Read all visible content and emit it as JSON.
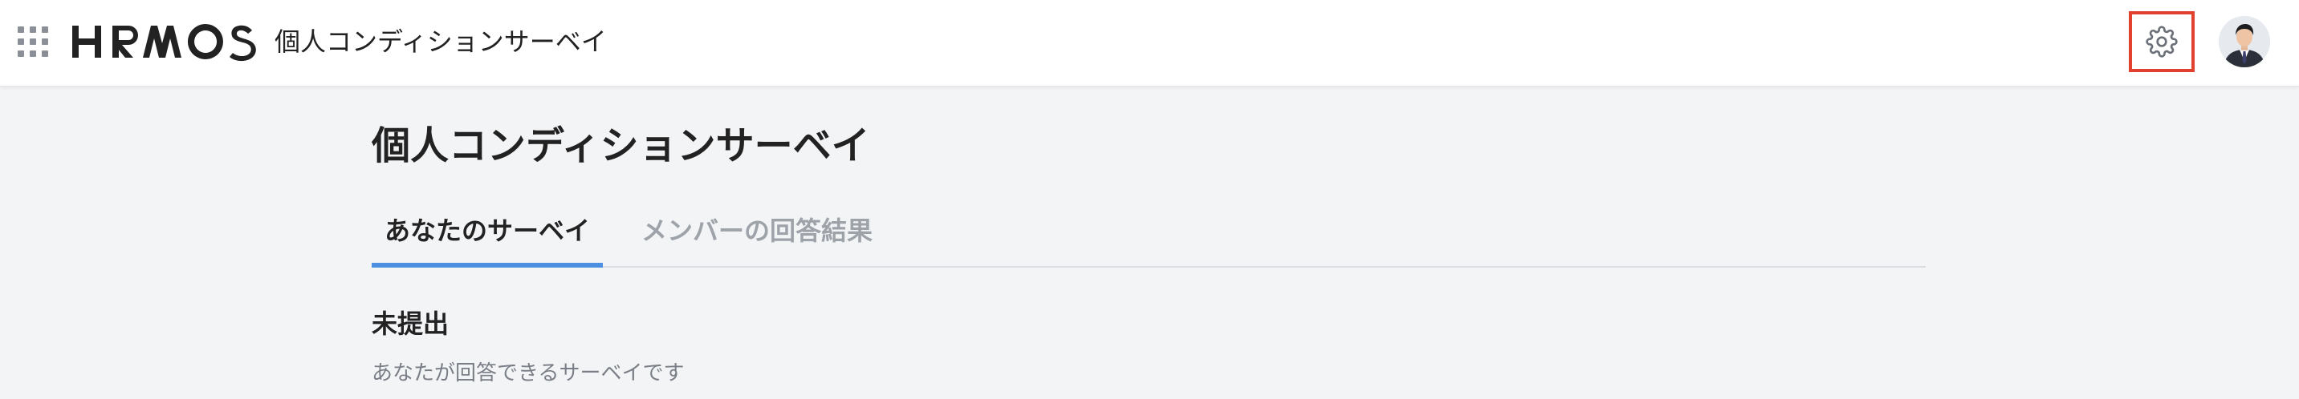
{
  "header": {
    "logo_text": "HRMOS",
    "app_name": "個人コンディションサーベイ",
    "icons": {
      "launcher": "app-grid-icon",
      "settings": "gear-icon",
      "avatar": "user-avatar"
    },
    "colors": {
      "highlight_border": "#e2412f",
      "icon_gray": "#8a8f98"
    }
  },
  "main": {
    "title": "個人コンディションサーベイ",
    "tabs": [
      {
        "label": "あなたのサーベイ",
        "active": true
      },
      {
        "label": "メンバーの回答結果",
        "active": false
      }
    ],
    "section": {
      "title": "未提出",
      "description": "あなたが回答できるサーベイです"
    },
    "colors": {
      "tab_active_underline": "#4a8fe0",
      "tab_inactive_text": "#9ea3aa",
      "background": "#f3f4f6"
    }
  }
}
